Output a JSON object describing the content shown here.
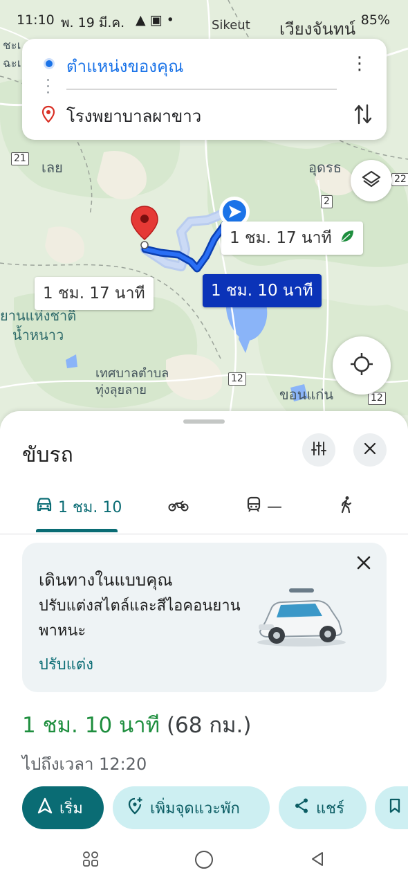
{
  "status_bar": {
    "time": "11:10",
    "date": "พ. 19 มี.ค.",
    "battery": "85%"
  },
  "map": {
    "labels": {
      "top_left_1": "ชะเ",
      "top_left_2": "ฉะเ",
      "sikeut": "Sikeut",
      "wiang": "เวียงจันทน์",
      "loei": "เลย",
      "udon": "อุดรธ",
      "park_1": "ยานแห่งชาติ",
      "park_2": "น้ำหนาว",
      "thesaban_1": "เทศบาลตำบล",
      "thesaban_2": "ทุ่งลุยลาย",
      "khon_kaen": "ขอนแก่น"
    },
    "road_badges": {
      "r21": "21",
      "r22": "22",
      "r2": "2",
      "r12a": "12",
      "r12b": "12"
    },
    "route_chips": {
      "eco": "1 ชม. 17 นาที",
      "alt": "1 ชม. 17 นาที",
      "active": "1 ชม. 10 นาที"
    },
    "colors": {
      "route_active": "#1a5cf0",
      "route_alt": "#a8c1f0",
      "pin": "#e53935",
      "eco_leaf": "#1e8e3e"
    }
  },
  "search": {
    "origin": "ตำแหน่งของคุณ",
    "destination": "โรงพยาบาลผาขาว"
  },
  "sheet": {
    "title": "ขับรถ",
    "tabs": [
      {
        "icon": "car-icon",
        "label": "1 ชม. 10",
        "active": true
      },
      {
        "icon": "motorcycle-icon",
        "label": ""
      },
      {
        "icon": "transit-icon",
        "label": "—"
      },
      {
        "icon": "walk-icon",
        "label": ""
      }
    ],
    "promo": {
      "title": "เดินทางในแบบคุณ",
      "body": "ปรับแต่งสไตล์และสีไอคอนยานพาหนะ",
      "link": "ปรับแต่ง"
    },
    "duration": "1 ชม. 10 นาที",
    "distance": "(68 กม.)",
    "arrival": "ไปถึงเวลา 12:20",
    "actions": {
      "start": "เริ่ม",
      "add_stop": "เพิ่มจุดแวะพัก",
      "share": "แชร์"
    },
    "accent": "#0a6c74"
  }
}
